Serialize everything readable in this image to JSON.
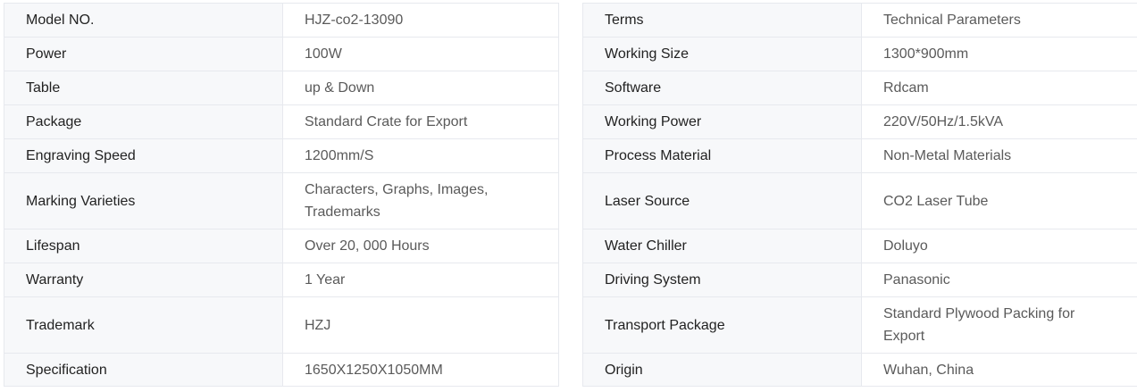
{
  "left_table": [
    {
      "key": "Model NO.",
      "value": "HJZ-co2-13090"
    },
    {
      "key": "Power",
      "value": "100W"
    },
    {
      "key": "Table",
      "value": "up & Down"
    },
    {
      "key": "Package",
      "value": "Standard Crate for Export"
    },
    {
      "key": "Engraving Speed",
      "value": "1200mm/S"
    },
    {
      "key": "Marking Varieties",
      "value": "Characters, Graphs, Images, Trademarks"
    },
    {
      "key": "Lifespan",
      "value": "Over 20, 000 Hours"
    },
    {
      "key": "Warranty",
      "value": "1 Year"
    },
    {
      "key": "Trademark",
      "value": "HZJ"
    },
    {
      "key": "Specification",
      "value": "1650X1250X1050MM"
    }
  ],
  "right_table": [
    {
      "key": "Terms",
      "value": "Technical Parameters"
    },
    {
      "key": "Working Size",
      "value": "1300*900mm"
    },
    {
      "key": "Software",
      "value": "Rdcam"
    },
    {
      "key": "Working Power",
      "value": "220V/50Hz/1.5kVA"
    },
    {
      "key": "Process Material",
      "value": "Non-Metal Materials"
    },
    {
      "key": "Laser Source",
      "value": "CO2 Laser Tube"
    },
    {
      "key": "Water Chiller",
      "value": "Doluyo"
    },
    {
      "key": "Driving System",
      "value": "Panasonic"
    },
    {
      "key": "Transport Package",
      "value": "Standard Plywood Packing for Export"
    },
    {
      "key": "Origin",
      "value": "Wuhan, China"
    }
  ]
}
